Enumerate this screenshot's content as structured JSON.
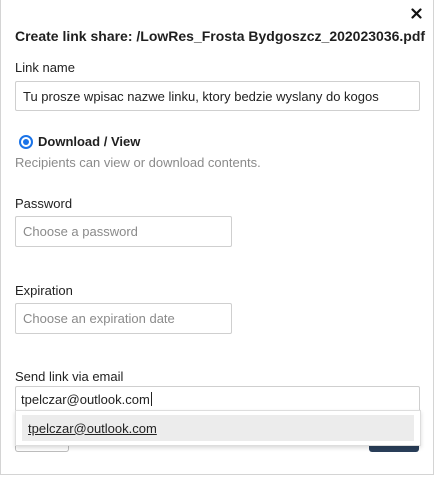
{
  "dialog": {
    "title": "Create link share: /LowRes_Frosta Bydgoszcz_202023036.pdf",
    "close_icon": "close-icon"
  },
  "link_name": {
    "label": "Link name",
    "value": "Tu prosze wpisac nazwe linku, ktory bedzie wyslany do kogos"
  },
  "permission": {
    "option_label": "Download / View",
    "description": "Recipients can view or download contents.",
    "selected": true,
    "accent_color": "#1a73e8"
  },
  "password": {
    "label": "Password",
    "placeholder": "Choose a password"
  },
  "expiration": {
    "label": "Expiration",
    "placeholder": "Choose an expiration date"
  },
  "email": {
    "label": "Send link via email",
    "value": "tpelczar@outlook.com",
    "suggestions": [
      "tpelczar@outlook.com"
    ]
  }
}
